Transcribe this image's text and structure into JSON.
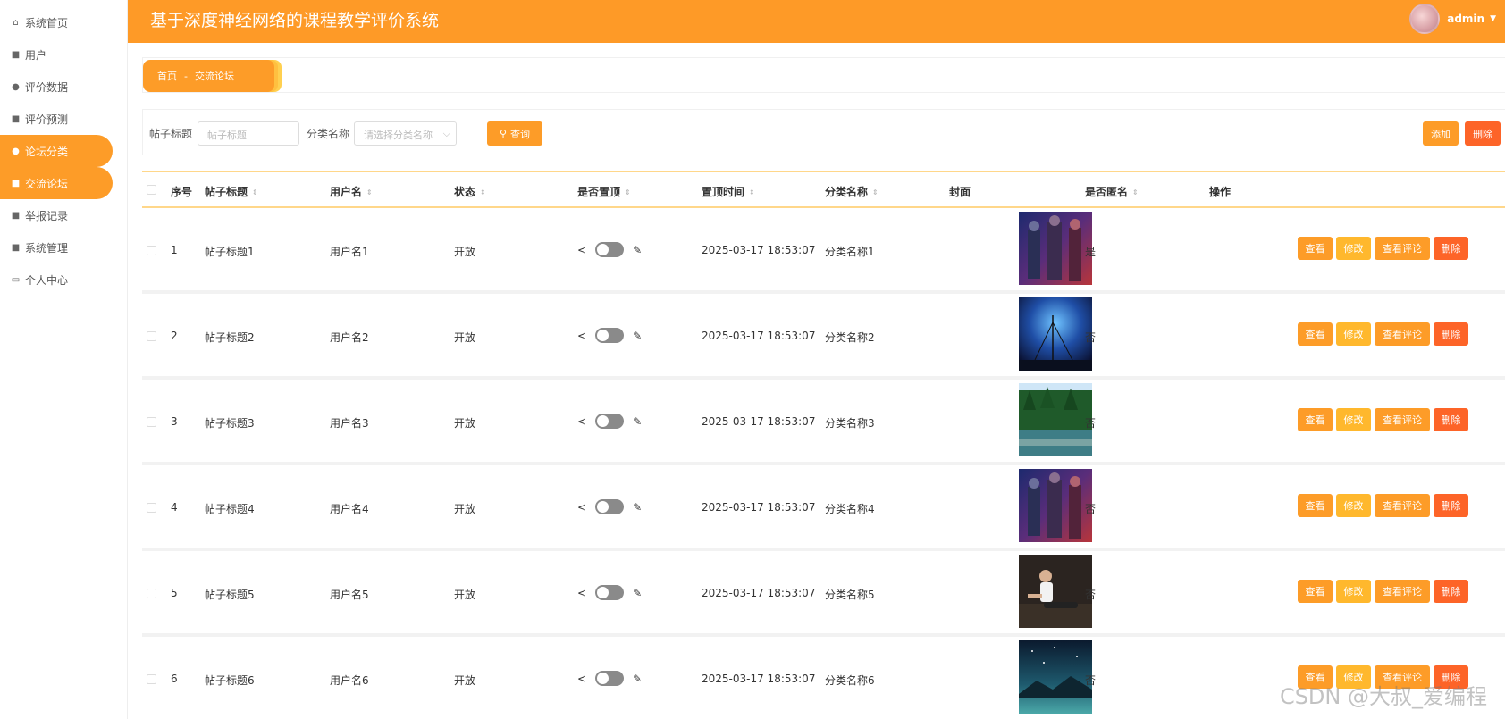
{
  "app": {
    "title": "基于深度神经网络的课程教学评价系统",
    "user": "admin"
  },
  "sidebar": {
    "items": [
      {
        "label": "系统首页",
        "icon": "home-icon",
        "active": false
      },
      {
        "label": "用户",
        "icon": "grid-icon",
        "active": false
      },
      {
        "label": "评价数据",
        "icon": "person-icon",
        "active": false
      },
      {
        "label": "评价预测",
        "icon": "clipboard-icon",
        "active": false
      },
      {
        "label": "论坛分类",
        "icon": "person-icon",
        "active": true
      },
      {
        "label": "交流论坛",
        "icon": "clipboard-icon",
        "active": true
      },
      {
        "label": "举报记录",
        "icon": "grid-icon",
        "active": false
      },
      {
        "label": "系统管理",
        "icon": "document-icon",
        "active": false
      },
      {
        "label": "个人中心",
        "icon": "card-icon",
        "active": false
      }
    ]
  },
  "breadcrumb": {
    "home": "首页",
    "separator": "-",
    "current": "交流论坛"
  },
  "search": {
    "title_label": "帖子标题",
    "title_placeholder": "帖子标题",
    "category_label": "分类名称",
    "category_placeholder": "请选择分类名称",
    "query_button": "查询",
    "add_button": "添加",
    "delete_button": "删除"
  },
  "table": {
    "headers": {
      "index": "序号",
      "title": "帖子标题",
      "username": "用户名",
      "status": "状态",
      "pinned": "是否置顶",
      "pin_time": "置顶时间",
      "category": "分类名称",
      "cover": "封面",
      "anonymous": "是否匿名",
      "actions": "操作"
    },
    "action_labels": {
      "view": "查看",
      "edit": "修改",
      "comments": "查看评论",
      "delete": "删除"
    },
    "rows": [
      {
        "index": "1",
        "title": "帖子标题1",
        "username": "用户名1",
        "status": "开放",
        "pin_time": "2025-03-17 18:53:07",
        "category": "分类名称1",
        "anonymous": "是",
        "cover": "cover-scifi"
      },
      {
        "index": "2",
        "title": "帖子标题2",
        "username": "用户名2",
        "status": "开放",
        "pin_time": "2025-03-17 18:53:07",
        "category": "分类名称2",
        "anonymous": "否",
        "cover": "cover-starry-sky"
      },
      {
        "index": "3",
        "title": "帖子标题3",
        "username": "用户名3",
        "status": "开放",
        "pin_time": "2025-03-17 18:53:07",
        "category": "分类名称3",
        "anonymous": "否",
        "cover": "cover-forest-river"
      },
      {
        "index": "4",
        "title": "帖子标题4",
        "username": "用户名4",
        "status": "开放",
        "pin_time": "2025-03-17 18:53:07",
        "category": "分类名称4",
        "anonymous": "否",
        "cover": "cover-scifi"
      },
      {
        "index": "5",
        "title": "帖子标题5",
        "username": "用户名5",
        "status": "开放",
        "pin_time": "2025-03-17 18:53:07",
        "category": "分类名称5",
        "anonymous": "否",
        "cover": "cover-fitness"
      },
      {
        "index": "6",
        "title": "帖子标题6",
        "username": "用户名6",
        "status": "开放",
        "pin_time": "2025-03-17 18:53:07",
        "category": "分类名称6",
        "anonymous": "否",
        "cover": "cover-night-lake"
      }
    ]
  },
  "watermark": "CSDN @大叔_爱编程",
  "colors": {
    "primary": "#fd9c28",
    "danger": "#fd6428",
    "warning": "#ffb82d"
  }
}
